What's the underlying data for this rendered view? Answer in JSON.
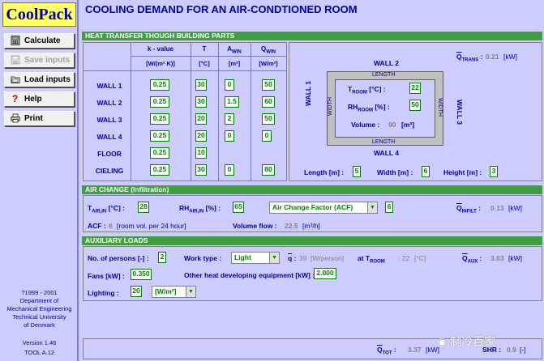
{
  "app": {
    "logo": "CoolPack",
    "title": "COOLING DEMAND FOR AN AIR-CONDTIONED ROOM"
  },
  "sidebar": {
    "buttons": [
      {
        "label": "Calculate",
        "icon": "calculator-icon",
        "enabled": true
      },
      {
        "label": "Save inputs",
        "icon": "save-icon",
        "enabled": false
      },
      {
        "label": "Load inputs",
        "icon": "folder-icon",
        "enabled": true
      },
      {
        "label": "Help",
        "icon": "help-icon",
        "enabled": true
      },
      {
        "label": "Print",
        "icon": "printer-icon",
        "enabled": true
      }
    ],
    "copyright": "?1999 - 2001",
    "dept1": "Department of",
    "dept2": "Mechanical Engineering",
    "univ1": "Technical University",
    "univ2": "of Denmark",
    "version": "Version 1.46",
    "tool": "TOOL A.12"
  },
  "heat_transfer": {
    "section_title": "HEAT TRANSFER THOUGH BUILDING PARTS",
    "col_k": "k - value",
    "col_k_unit": "[W/(m² K)]",
    "col_t": "T",
    "col_t_unit": "[°C]",
    "col_a": "A",
    "col_a_sub": "WIN",
    "col_a_unit": "[m²]",
    "col_q": "Q",
    "col_q_sub": "WIN",
    "col_q_unit": "[W/m²]",
    "rows": [
      {
        "label": "WALL 1",
        "k": "0.25",
        "t": "30",
        "a": "0",
        "q": "50"
      },
      {
        "label": "WALL 2",
        "k": "0.25",
        "t": "30",
        "a": "1.5",
        "q": "60"
      },
      {
        "label": "WALL 3",
        "k": "0.25",
        "t": "20",
        "a": "2",
        "q": "50"
      },
      {
        "label": "WALL 4",
        "k": "0.25",
        "t": "20",
        "a": "0",
        "q": "0"
      },
      {
        "label": "FLOOR",
        "k": "0.25",
        "t": "10",
        "a": "",
        "q": ""
      },
      {
        "label": "CIELING",
        "k": "0.25",
        "t": "30",
        "a": "0",
        "q": "80"
      }
    ],
    "q_trans_label": "Q",
    "q_trans_sub": "TRANS",
    "q_trans_value": "0.21",
    "q_trans_unit": "[kW]"
  },
  "room": {
    "wall1": "WALL 1",
    "wall2": "WALL 2",
    "wall3": "WALL 3",
    "wall4": "WALL 4",
    "width_left": "WIDTH",
    "width_right": "WIDTH",
    "length_top": "LENGTH",
    "length_bottom": "LENGTH",
    "troom_label": "T",
    "troom_sub": "ROOM",
    "troom_unit": "[°C] :",
    "troom_value": "22",
    "rh_label": "RH",
    "rh_sub": "ROOM",
    "rh_unit": "[%] :",
    "rh_value": "50",
    "volume_label": "Volume :",
    "volume_value": "90",
    "volume_unit": "[m³]",
    "length_label": "Length [m] :",
    "length_value": "5",
    "width_label": "Width [m] :",
    "width_value": "6",
    "height_label": "Height [m] :",
    "height_value": "3"
  },
  "air_change": {
    "section_title": "AIR CHANGE (Infiltration)",
    "t_air_label": "T",
    "t_air_sub": "AIR,IN",
    "t_air_unit": "[°C] :",
    "t_air_value": "28",
    "rh_air_label": "RH",
    "rh_air_sub": "AIR,IN",
    "rh_air_unit": "[%] :",
    "rh_air_value": "65",
    "acf_select": "Air Change Factor (ACF)",
    "acf_value": "6",
    "q_infilt_label": "Q",
    "q_infilt_sub": "INFILT",
    "q_infilt_value": "0.13",
    "q_infilt_unit": "[kW]",
    "acf_info_label": "ACF :",
    "acf_info_value": "6",
    "acf_info_unit": "[room vol. per 24 hour]",
    "vol_flow_label": "Volume flow :",
    "vol_flow_value": "22.5",
    "vol_flow_unit": "[m³/h]"
  },
  "aux": {
    "section_title": "AUXILIARY LOADS",
    "persons_label": "No. of persons [-] :",
    "persons_value": "2",
    "work_label": "Work type :",
    "work_value": "Light",
    "q_person_label": "q :",
    "q_person_value": "39",
    "q_person_unit": "[W/person]",
    "at_troom_label": "at T",
    "at_troom_sub": "ROOM",
    "at_troom_value": ": 22",
    "at_troom_unit": "[°C]",
    "q_aux_label": "Q",
    "q_aux_sub": "AUX",
    "q_aux_value": "3.03",
    "q_aux_unit": "[kW]",
    "fans_label": "Fans [kW] :",
    "fans_value": "0.350",
    "other_label": "Other heat developing equipment [kW] :",
    "other_value": "2.000",
    "lighting_label": "Lighting :",
    "lighting_value": "20",
    "lighting_unit": "[W/m²]"
  },
  "totals": {
    "q_tot_label": "Q",
    "q_tot_sub": "TOT",
    "q_tot_value": "3.37",
    "q_tot_unit": "[kW]",
    "shr_label": "SHR :",
    "shr_value": "0.9",
    "shr_unit": "[-]",
    "watermark": "制冷百家"
  }
}
